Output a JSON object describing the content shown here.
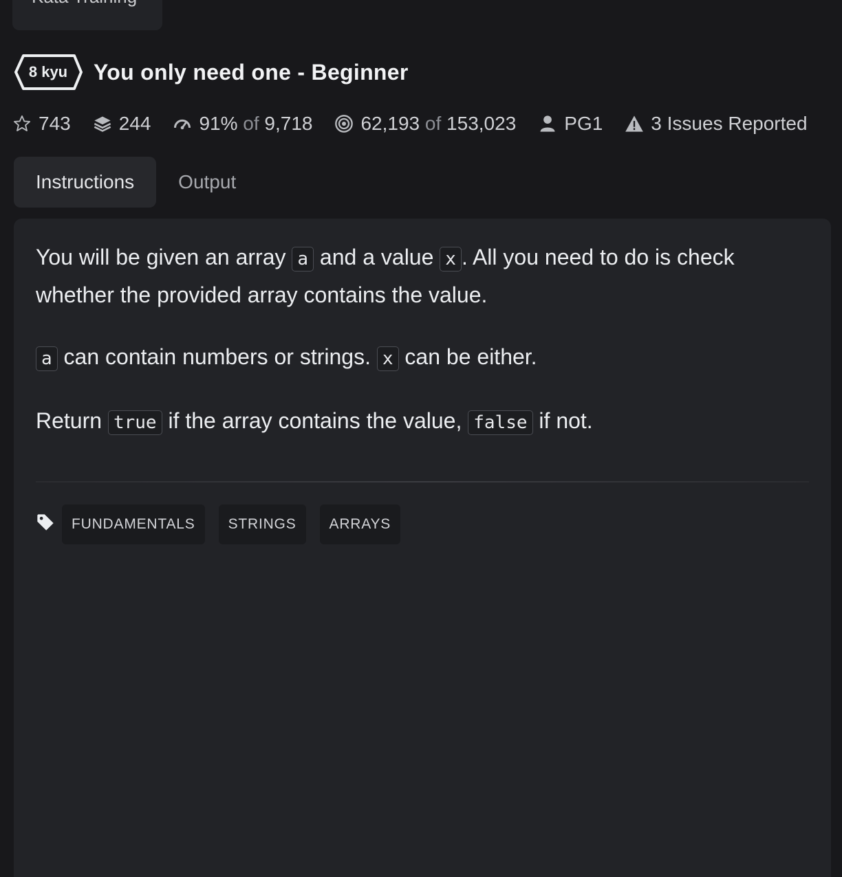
{
  "nav": {
    "kata_training_label": "Kata Training"
  },
  "kata": {
    "rank": "8 kyu",
    "title": "You only need one - Beginner"
  },
  "stats": {
    "stars": "743",
    "collections": "244",
    "satisfaction_percent": "91%",
    "satisfaction_of": "of",
    "satisfaction_votes": "9,718",
    "completed": "62,193",
    "completed_of": "of",
    "attempted": "153,023",
    "author": "PG1",
    "issues": "3 Issues Reported"
  },
  "tabs": [
    {
      "label": "Instructions",
      "active": true
    },
    {
      "label": "Output",
      "active": false
    }
  ],
  "description": {
    "p1_t1": "You will be given an array ",
    "p1_code1": "a",
    "p1_t2": " and a value ",
    "p1_code2": "x",
    "p1_t3": ". All you need to do is check whether the provided array contains the value.",
    "p2_code1": "a",
    "p2_t1": " can contain numbers or strings. ",
    "p2_code2": "x",
    "p2_t2": " can be either.",
    "p3_t1": "Return ",
    "p3_code1": "true",
    "p3_t2": " if the array contains the value, ",
    "p3_code2": "false",
    "p3_t3": " if not."
  },
  "tags": [
    "FUNDAMENTALS",
    "STRINGS",
    "ARRAYS"
  ],
  "icons": {
    "stars": "star-outline-icon",
    "collections": "layers-icon",
    "satisfaction": "speedometer-icon",
    "completed": "target-icon",
    "author": "user-icon",
    "issues": "warning-triangle-icon",
    "tags": "tag-icon"
  },
  "colors": {
    "background": "#18181b",
    "panel": "#222327",
    "text": "#eceef1",
    "muted": "#8d8f95"
  }
}
